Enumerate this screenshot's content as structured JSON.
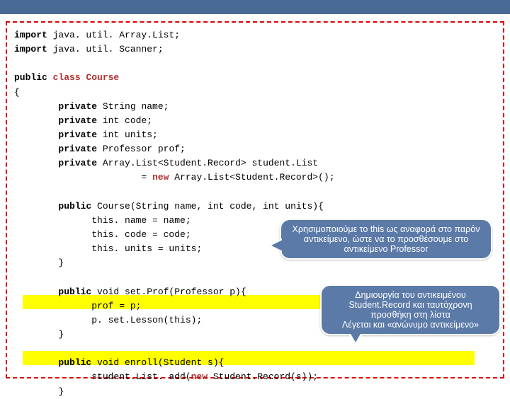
{
  "code": {
    "line1_kw": "import",
    "line1_rest": " java. util. Array.List;",
    "line2_kw": "import",
    "line2_rest": " java. util. Scanner;",
    "line3_kw": "public",
    "line3_cl": " class Course",
    "brace_open": "{",
    "f1_kw": "        private",
    "f1_rest": " String name;",
    "f2_kw": "        private",
    "f2_rest": " int code;",
    "f3_kw": "        private",
    "f3_rest": " int units;",
    "f4_kw": "        private",
    "f4_rest": " Professor prof;",
    "f5_kw": "        private",
    "f5_rest": " Array.List<Student.Record> student.List",
    "f5_cont_a": "                       = ",
    "f5_cont_new": "new",
    "f5_cont_b": " Array.List<Student.Record>();",
    "ctor_kw": "        public",
    "ctor_rest": " Course(String name, int code, int units){",
    "ctor_b1": "              this. name = name;",
    "ctor_b2": "              this. code = code;",
    "ctor_b3": "              this. units = units;",
    "ctor_close": "        }",
    "sp_kw": "        public",
    "sp_rest": " void set.Prof(Professor p){",
    "sp_b1": "              prof = p;",
    "sp_b2": "              p. set.Lesson(this);",
    "sp_close": "        }",
    "en_kw": "        public",
    "en_rest": " void enroll(Student s){",
    "en_b1a": "              student.List. add(",
    "en_b1_new": "new",
    "en_b1b": " Student.Record(s));",
    "en_close": "        }"
  },
  "callouts": {
    "c1": "Χρησιμοποιούμε το this ως αναφορά στο παρόν αντικείμενο, ώστε να το προσθέσουμε στο αντικείμενο Professor",
    "c2": "Δημιουργία του αντικειμένου Student.Record και ταυτόχρονη προσθήκη στη λίστα\nΛέγεται και «ανώνυμο αντικείμενο»"
  }
}
